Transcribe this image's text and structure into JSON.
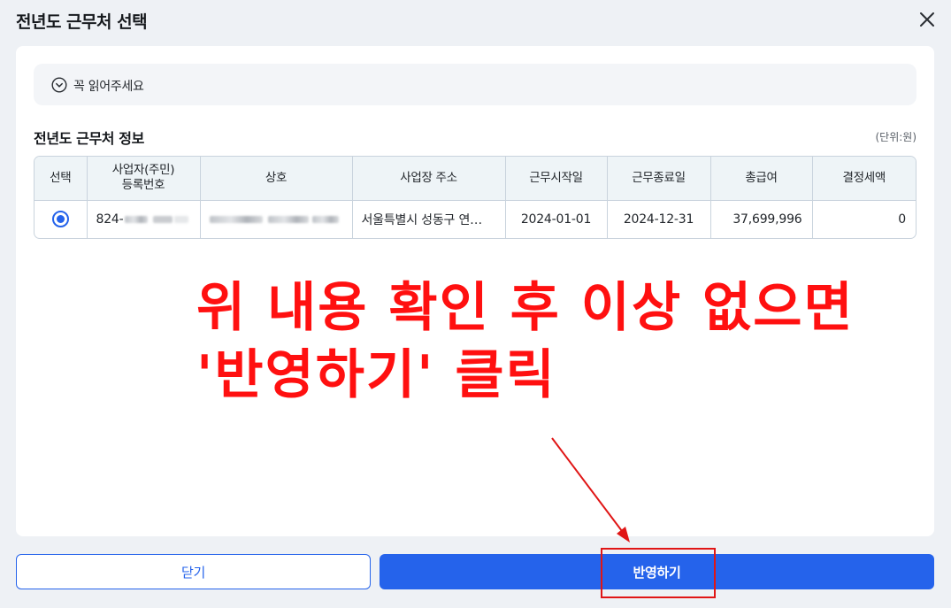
{
  "modal": {
    "title": "전년도 근무처 선택",
    "close_icon": "close-icon"
  },
  "notice": {
    "icon": "chevron-down-circle-icon",
    "text": "꼭 읽어주세요"
  },
  "section": {
    "title": "전년도 근무처 정보",
    "unit": "(단위:원)"
  },
  "table": {
    "headers": [
      "선택",
      "사업자(주민)\n등록번호",
      "상호",
      "사업장 주소",
      "근무시작일",
      "근무종료일",
      "총급여",
      "결정세액"
    ],
    "rows": [
      {
        "selected": true,
        "reg_no": "824-",
        "company": "",
        "address": "서울특별시 성동구 연…",
        "start_date": "2024-01-01",
        "end_date": "2024-12-31",
        "total_salary": "37,699,996",
        "tax": "0"
      }
    ]
  },
  "annotation": {
    "line1": "위 내용 확인 후 이상 없으면",
    "line2": "'반영하기' 클릭",
    "color": "#ff1010"
  },
  "footer": {
    "close_label": "닫기",
    "apply_label": "반영하기"
  },
  "colors": {
    "accent": "#2563eb",
    "table_header_bg": "#eef4f7"
  }
}
